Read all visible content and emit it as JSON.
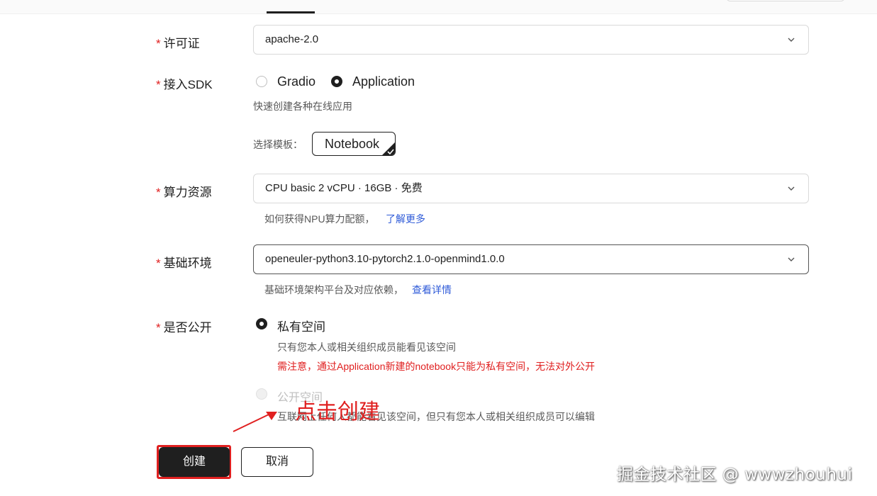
{
  "license": {
    "label": "许可证",
    "value": "apache-2.0"
  },
  "sdk": {
    "label": "接入SDK",
    "options": [
      {
        "label": "Gradio",
        "checked": false
      },
      {
        "label": "Application",
        "checked": true
      }
    ],
    "hint": "快速创建各种在线应用",
    "template_label": "选择模板：",
    "template_value": "Notebook"
  },
  "compute": {
    "label": "算力资源",
    "value": "CPU basic 2 vCPU · 16GB · 免费",
    "hint": "如何获得NPU算力配额，",
    "link": "了解更多"
  },
  "env": {
    "label": "基础环境",
    "value": "openeuler-python3.10-pytorch2.1.0-openmind1.0.0",
    "hint": "基础环境架构平台及对应依赖，",
    "link": "查看详情"
  },
  "visibility": {
    "label": "是否公开",
    "private": {
      "label": "私有空间",
      "checked": true,
      "hint": "只有您本人或相关组织成员能看见该空间",
      "warning": "需注意，通过Application新建的notebook只能为私有空间，无法对外公开"
    },
    "public": {
      "label": "公开空间",
      "disabled": true,
      "hint": "互联网上任何人都能看见该空间，但只有您本人或相关组织成员可以编辑"
    }
  },
  "required_mark": "*",
  "actions": {
    "create": "创建",
    "cancel": "取消"
  },
  "annotation": "点击创建",
  "watermark": "掘金技术社区 @ wwwzhouhui",
  "colors": {
    "accent": "#1f1f1f",
    "required": "#e02020",
    "link": "#2f5bd8"
  }
}
